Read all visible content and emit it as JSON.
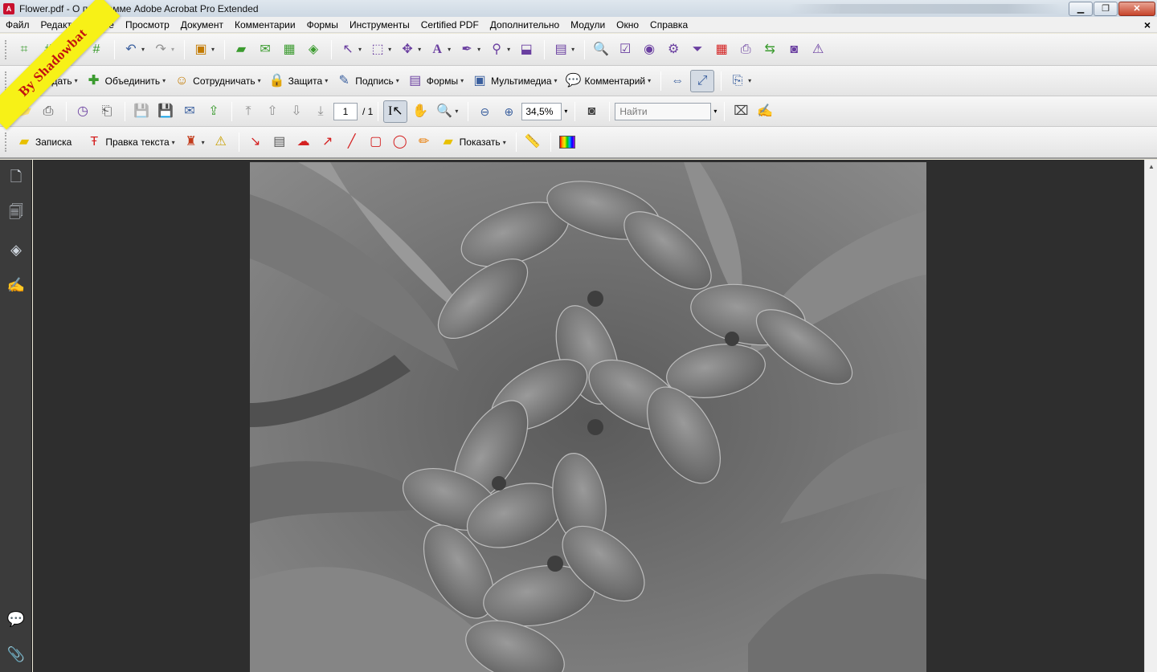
{
  "window": {
    "title": "Flower.pdf - О программе Adobe Acrobat Pro Extended",
    "app_icon_text": "A",
    "minimize": "▁",
    "maximize": "❐",
    "close": "✕"
  },
  "watermark": "By Shadowbat",
  "menu": {
    "items": [
      "Файл",
      "Редактирование",
      "Просмотр",
      "Документ",
      "Комментарии",
      "Формы",
      "Инструменты",
      "Certified PDF",
      "Дополнительно",
      "Модули",
      "Окно",
      "Справка"
    ],
    "close": "×"
  },
  "toolbar2": {
    "create": "Создать",
    "combine": "Объединить",
    "collaborate": "Сотрудничать",
    "secure": "Защита",
    "sign": "Подпись",
    "forms": "Формы",
    "multimedia": "Мультимедиа",
    "comment": "Комментарий"
  },
  "toolbar3": {
    "page_current": "1",
    "page_total": "/ 1",
    "zoom": "34,5%",
    "find_placeholder": "Найти"
  },
  "toolbar4": {
    "sticky_note": "Записка",
    "text_edit": "Правка текста",
    "show": "Показать"
  },
  "icons": {
    "open": "📂",
    "print": "🖶",
    "email": "✉",
    "hand": "✋",
    "select": "I",
    "zoom": "🔍",
    "camera": "📷"
  },
  "colors": {
    "accent_green": "#3b9b2f",
    "accent_purple": "#6a3fa0",
    "accent_red": "#d42020",
    "doc_bg": "#2e2e2e",
    "nav_bg": "#3b3b3b"
  }
}
